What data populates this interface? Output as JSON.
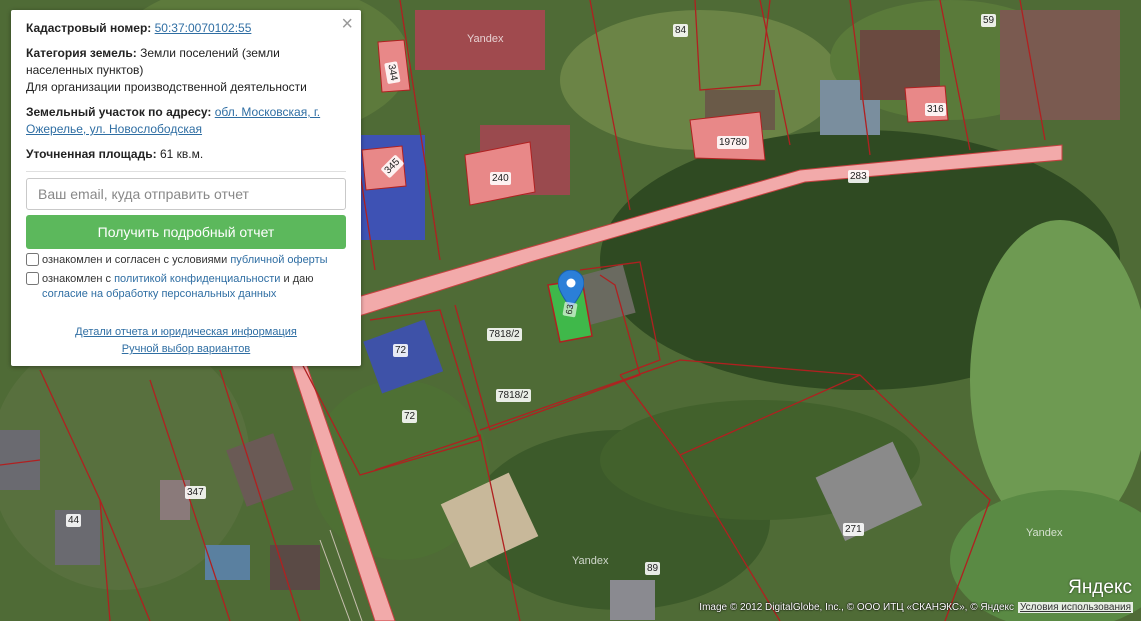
{
  "popup": {
    "close_glyph": "×",
    "cadastral_label": "Кадастровый номер:",
    "cadastral_number": "50:37:0070102:55",
    "category_label": "Категория земель:",
    "category_value": "Земли поселений (земли населенных пунктов)",
    "usage": "Для организации производственной деятельности",
    "address_label": "Земельный участок по адресу:",
    "address_value": "обл. Московская, г. Ожерелье, ул. Новослободская",
    "area_label": "Уточненная площадь:",
    "area_value": "61 кв.м.",
    "email_placeholder": "Ваш email, куда отправить отчет",
    "submit_label": "Получить подробный отчет",
    "offer_text": "ознакомлен и согласен с условиями",
    "offer_link": "публичной оферты",
    "privacy_text_1": "ознакомлен с",
    "privacy_link": "политикой конфиденциальности",
    "privacy_text_2": "и даю",
    "consent_link": "согласие на обработку персональных данных",
    "details_link": "Детали отчета и юридическая информация",
    "manual_link": "Ручной выбор вариантов"
  },
  "parcel_labels": [
    "344",
    "345",
    "240",
    "19780",
    "316",
    "84",
    "59",
    "283",
    "72",
    "72",
    "7818/2",
    "7818/2",
    "347",
    "44",
    "271",
    "89"
  ],
  "marker_label": "63",
  "watermarks": [
    "Yandex",
    "Yandex",
    "Yandex"
  ],
  "map_footer": {
    "logo": "Яндекс",
    "copyright": "Image © 2012 DigitalGlobe, Inc., © ООО ИТЦ «СКАНЭКС», © Яндекс",
    "terms": "Условия использования"
  },
  "colors": {
    "parcel_border": "#b02020",
    "parcel_fill": "#e88888",
    "road_fill": "#f0a8a8",
    "selected_parcel": "#3fb84a",
    "marker": "#2b7fd8",
    "button": "#5cb85c"
  }
}
